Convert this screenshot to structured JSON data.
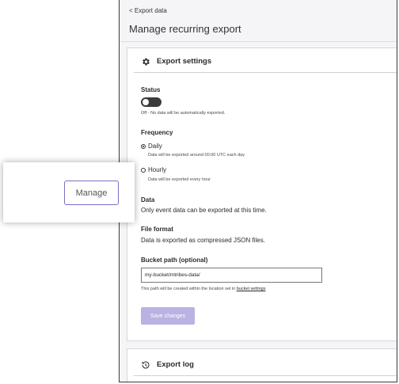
{
  "breadcrumb": "< Export data",
  "page_title": "Manage recurring export",
  "settings": {
    "heading": "Export settings",
    "status_label": "Status",
    "status_hint": "Off - No data will be automatically exported.",
    "frequency_label": "Frequency",
    "daily_label": "Daily",
    "daily_hint": "Data will be exported around 00:00 UTC each day",
    "hourly_label": "Hourly",
    "hourly_hint": "Data will be exported every hour",
    "data_label": "Data",
    "data_text": "Only event data can be exported at this time.",
    "format_label": "File format",
    "format_text": "Data is exported as compressed JSON files.",
    "bucket_label": "Bucket path (optional)",
    "bucket_value": "my-bucket/mtribes-data/",
    "bucket_hint_prefix": "This path will be created within the location set in ",
    "bucket_hint_link": "bucket settings",
    "save_label": "Save changes"
  },
  "export_log": {
    "heading": "Export log"
  },
  "popout": {
    "manage_label": "Manage"
  },
  "colors": {
    "accent": "#7a6fc9",
    "save_button": "#b9b2e3",
    "toggle_off": "#3b3b3b"
  }
}
